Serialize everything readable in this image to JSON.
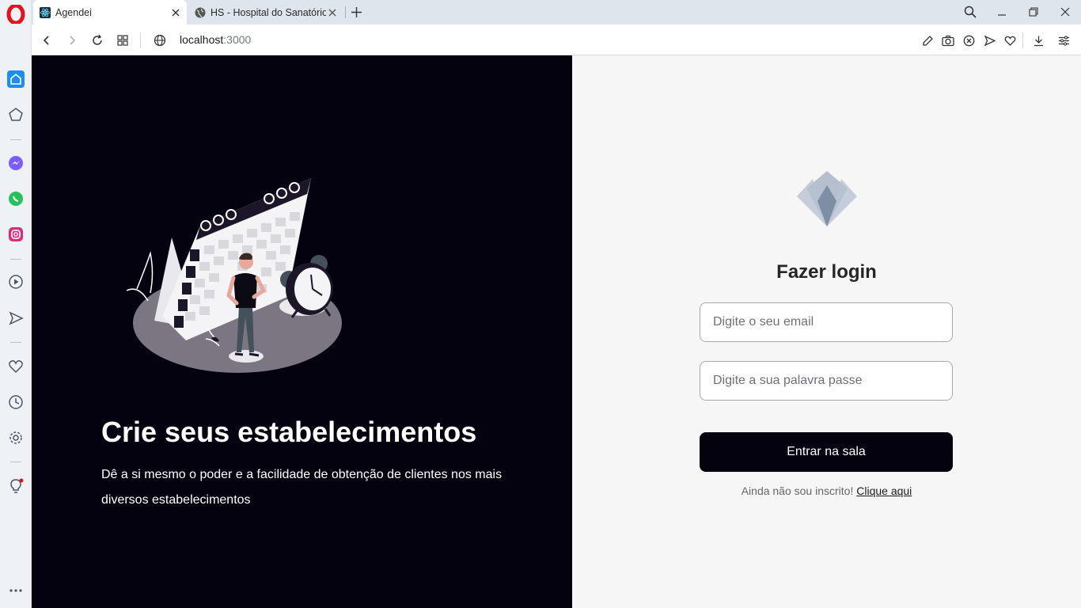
{
  "browser": {
    "tabs": [
      {
        "label": "Agendei",
        "active": true,
        "favicon": "react-icon"
      },
      {
        "label": "HS - Hospital do Sanatório",
        "active": false,
        "favicon": "globe-icon"
      }
    ],
    "url_host": "localhost",
    "url_port": ":3000"
  },
  "hero": {
    "title": "Crie seus estabelecimentos",
    "description": "Dê a si mesmo o poder e a facilidade de obtenção de clientes nos mais diversos estabelecimentos"
  },
  "login": {
    "title": "Fazer login",
    "email_placeholder": "Digite o seu email",
    "password_placeholder": "Digite a sua palavra passe",
    "submit_label": "Entrar na sala",
    "signup_prompt": "Ainda não sou inscrito!",
    "signup_link": "Clique aqui"
  },
  "colors": {
    "dark_panel": "#05020f",
    "light_panel": "#f6f6f6",
    "opera_red": "#e1141e"
  }
}
